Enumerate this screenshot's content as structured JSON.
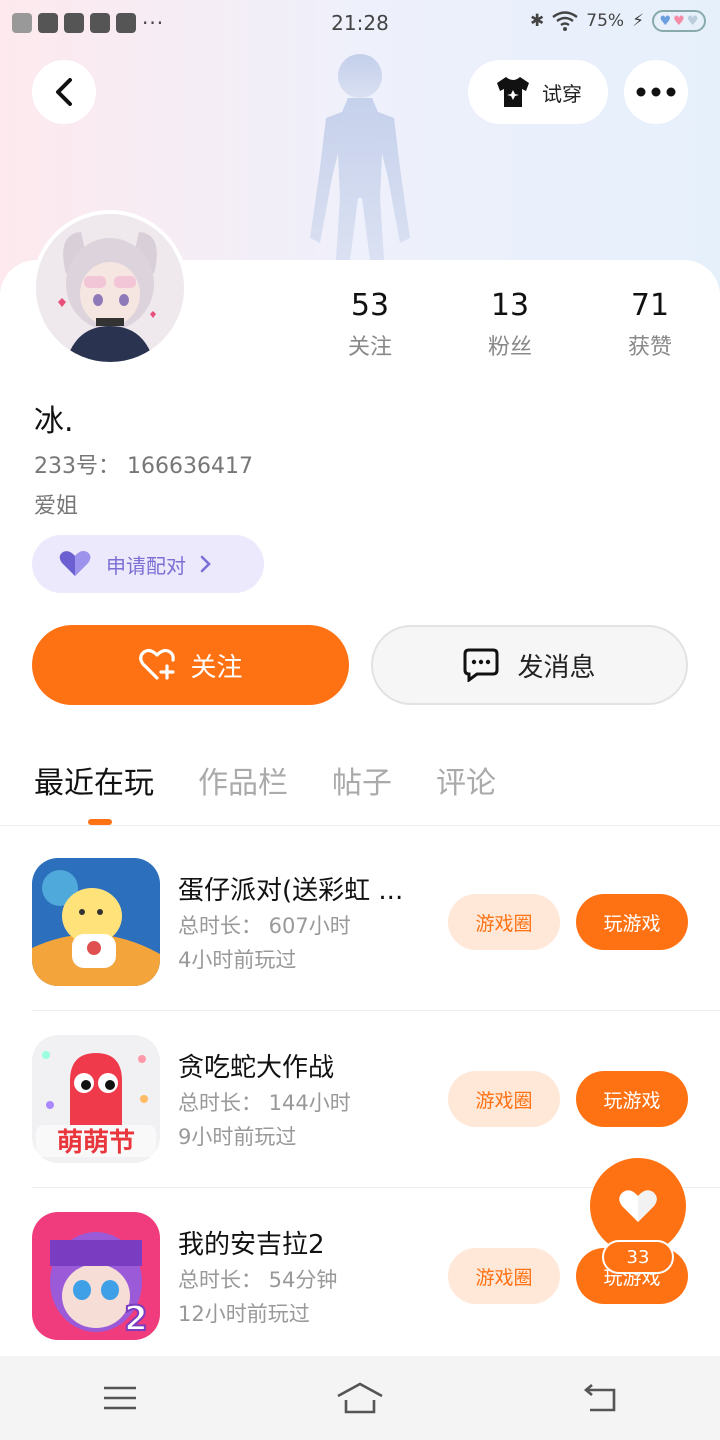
{
  "status_bar": {
    "time": "21:28",
    "battery": "75%",
    "more": "···"
  },
  "header": {
    "try_on_label": "试穿"
  },
  "profile": {
    "stats": [
      {
        "value": "53",
        "label": "关注"
      },
      {
        "value": "13",
        "label": "粉丝"
      },
      {
        "value": "71",
        "label": "获赞"
      }
    ],
    "username": "冰.",
    "uid": "233号： 166636417",
    "bio": "爱姐",
    "pair_label": "申请配对"
  },
  "actions": {
    "follow_label": "关注",
    "message_label": "发消息"
  },
  "tabs": [
    {
      "label": "最近在玩",
      "active": true
    },
    {
      "label": "作品栏",
      "active": false
    },
    {
      "label": "帖子",
      "active": false
    },
    {
      "label": "评论",
      "active": false
    }
  ],
  "games": [
    {
      "title": "蛋仔派对(送彩虹 ...",
      "time": "总时长： 607小时",
      "last": "4小时前玩过",
      "circle": "游戏圈",
      "play": "玩游戏"
    },
    {
      "title": "贪吃蛇大作战",
      "time": "总时长： 144小时",
      "last": "9小时前玩过",
      "circle": "游戏圈",
      "play": "玩游戏",
      "icon_text": "萌萌节"
    },
    {
      "title": "我的安吉拉2",
      "time": "总时长： 54分钟",
      "last": "12小时前玩过",
      "circle": "游戏圈",
      "play": "玩游戏",
      "icon_text": "2"
    }
  ],
  "like": {
    "count": "33"
  },
  "colors": {
    "accent": "#ff7214",
    "pair": "#7b6fd6"
  }
}
